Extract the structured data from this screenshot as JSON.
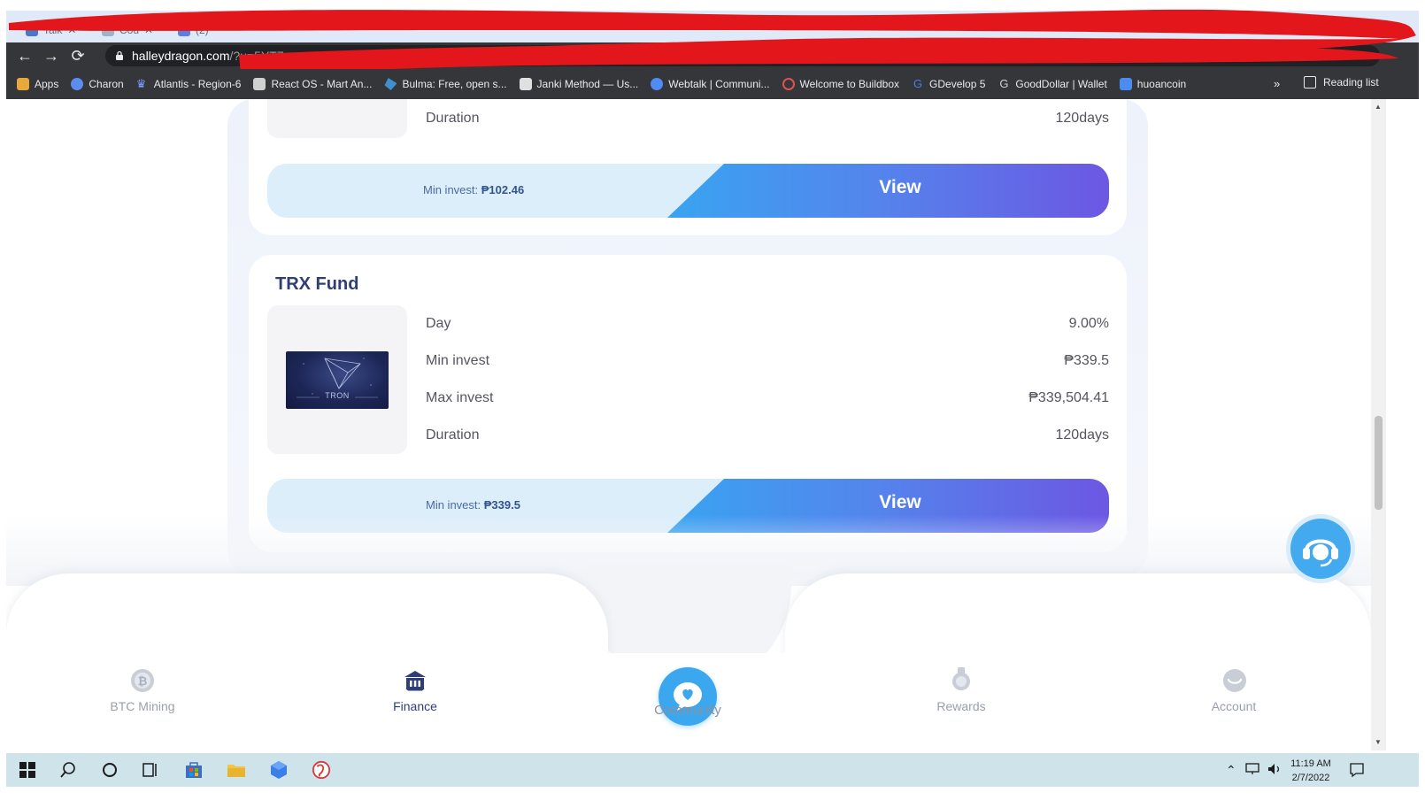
{
  "browser": {
    "tabs": [
      {
        "label": "Talk"
      },
      {
        "label": "Cou"
      },
      {
        "label": "(2)"
      }
    ],
    "url_host": "halleydragon.com",
    "url_rest": "/?u=5YT7",
    "bookmarks": [
      {
        "label": "Apps",
        "icon": "apps-grid-icon",
        "color": "#e8a83a"
      },
      {
        "label": "Charon",
        "icon": "charon-icon",
        "color": "#5b8def"
      },
      {
        "label": "Atlantis - Region-6",
        "icon": "crown-icon",
        "color": "#7aa0ff"
      },
      {
        "label": "React OS - Mart An...",
        "icon": "reactos-icon",
        "color": "#d0d0d0"
      },
      {
        "label": "Bulma: Free, open s...",
        "icon": "bulma-icon",
        "color": "#3e8ed0"
      },
      {
        "label": "Janki Method — Us...",
        "icon": "janki-icon",
        "color": "#e0e0e0"
      },
      {
        "label": "Webtalk | Communi...",
        "icon": "webtalk-icon",
        "color": "#4f8cf5"
      },
      {
        "label": "Welcome to Buildbox",
        "icon": "buildbox-icon",
        "color": "#e05252"
      },
      {
        "label": "GDevelop 5",
        "icon": "gdevelop-icon",
        "color": "#4b7bec"
      },
      {
        "label": "GoodDollar | Wallet",
        "icon": "gooddollar-icon",
        "color": "#cfcfcf"
      },
      {
        "label": "huoancoin",
        "icon": "huoancoin-icon",
        "color": "#4a8df0"
      }
    ],
    "more": "»",
    "reading_list": "Reading list"
  },
  "top_card": {
    "duration_label": "Duration",
    "duration_value": "120days",
    "min_invest_label": "Min invest:",
    "min_invest_value": "₱102.46",
    "view_label": "View"
  },
  "trx_card": {
    "title": "TRX Fund",
    "image_label": "TRON",
    "rows": [
      {
        "label": "Day",
        "value": "9.00%"
      },
      {
        "label": "Min invest",
        "value": "₱339.5"
      },
      {
        "label": "Max invest",
        "value": "₱339,504.41"
      },
      {
        "label": "Duration",
        "value": "120days"
      }
    ],
    "min_invest_label": "Min invest:",
    "min_invest_value": "₱339.5",
    "view_label": "View"
  },
  "bottom_nav": {
    "items": [
      {
        "label": "BTC Mining",
        "icon": "bitcoin-icon",
        "active": false
      },
      {
        "label": "Finance",
        "icon": "bank-icon",
        "active": true
      },
      {
        "label": "Community",
        "icon": "chat-heart-icon",
        "active": false
      },
      {
        "label": "Rewards",
        "icon": "medal-icon",
        "active": false
      },
      {
        "label": "Account",
        "icon": "account-icon",
        "active": false
      }
    ],
    "active_color": "#2f3e77",
    "inactive_color": "#9aa0aa"
  },
  "taskbar": {
    "time": "11:19 AM",
    "date": "2/7/2022"
  },
  "colors": {
    "accent_blue": "#3aa7ef",
    "gradient_end": "#6c57e3",
    "title_navy": "#2f3e77"
  }
}
